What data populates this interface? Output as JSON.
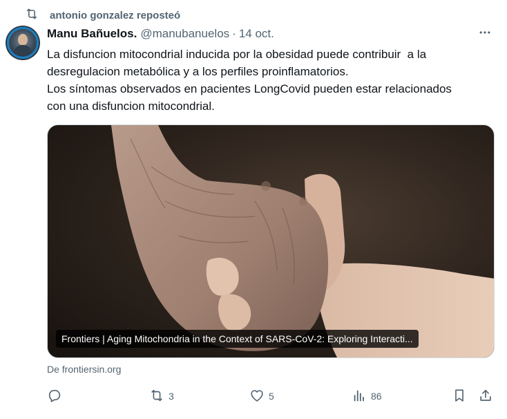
{
  "repost": {
    "icon": "repost-icon",
    "text": "antonio gonzalez reposteó"
  },
  "tweet": {
    "avatar": "avatar",
    "author": "Manu Bañuelos.",
    "handle": "@manubanuelos",
    "separator": "·",
    "date": "14 oct.",
    "more_icon": "more-icon",
    "lines": [
      "La disfuncion mitocondrial inducida por la obesidad puede contribuir  a la",
      "desregulacion metabólica y a los perfiles proinflamatorios.",
      "Los síntomas observados en pacientes LongCovid pueden estar relacionados",
      "con una disfuncion mitocondrial."
    ]
  },
  "card": {
    "image_description": "elderly-hand-holding-child-hand-photo",
    "caption": "Frontiers | Aging Mitochondria in the Context of SARS-CoV-2: Exploring Interacti...",
    "source": "De frontiersin.org"
  },
  "actions": {
    "reply": {
      "icon": "reply-icon",
      "count": ""
    },
    "retweet": {
      "icon": "retweet-icon",
      "count": "3"
    },
    "like": {
      "icon": "like-icon",
      "count": "5"
    },
    "views": {
      "icon": "views-icon",
      "count": "86"
    },
    "bookmark": {
      "icon": "bookmark-icon"
    },
    "share": {
      "icon": "share-icon"
    }
  },
  "colors": {
    "text": "#0f1419",
    "secondary": "#536471",
    "border": "#cfd9de"
  }
}
